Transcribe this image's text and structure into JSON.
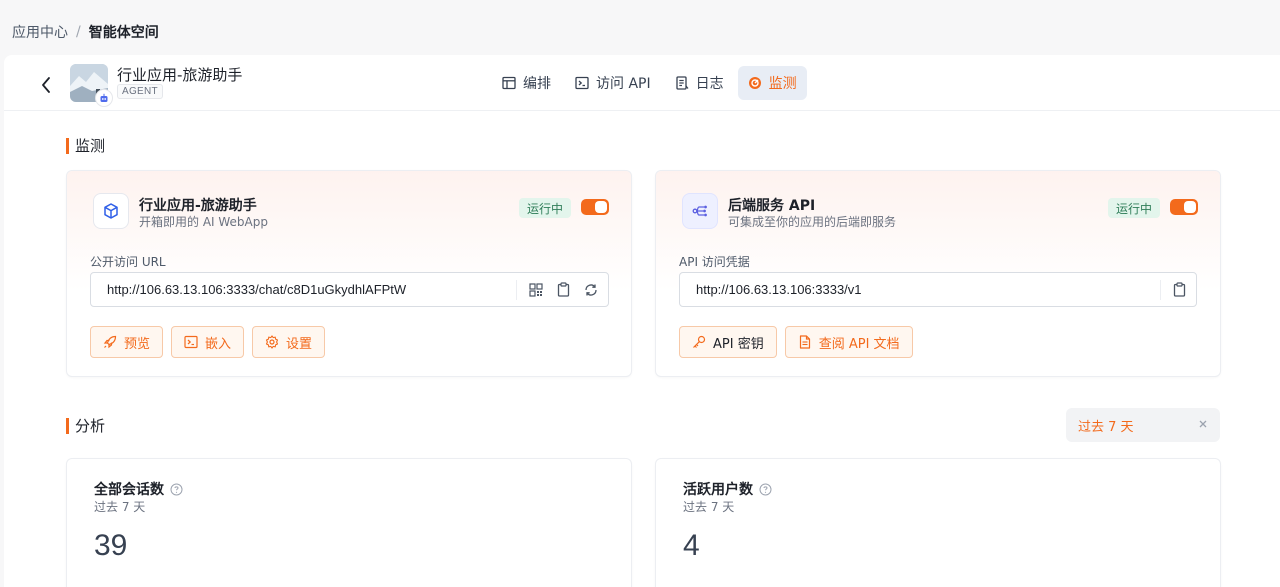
{
  "breadcrumb": {
    "root": "应用中心",
    "separator": "/",
    "current": "智能体空间"
  },
  "app": {
    "name": "行业应用-旅游助手",
    "type_tag": "AGENT",
    "thumb_icon": "snow-mountain-image",
    "badge_icon": "robot-icon"
  },
  "tabs": [
    {
      "label": "编排",
      "icon": "layout-icon",
      "active": false
    },
    {
      "label": "访问 API",
      "icon": "terminal-icon",
      "active": false
    },
    {
      "label": "日志",
      "icon": "document-icon",
      "active": false
    },
    {
      "label": "监测",
      "icon": "monitor-icon",
      "active": true
    }
  ],
  "monitor": {
    "section_title": "监测",
    "webapp": {
      "title": "行业应用-旅游助手",
      "subtitle": "开箱即用的 AI WebApp",
      "status": "运行中",
      "enabled": true,
      "url_label": "公开访问 URL",
      "url": "http://106.63.13.106:3333/chat/c8D1uGkydhlAFPtW",
      "buttons": {
        "preview": "预览",
        "embed": "嵌入",
        "settings": "设置"
      }
    },
    "backend": {
      "title": "后端服务 API",
      "subtitle": "可集成至你的应用的后端即服务",
      "status": "运行中",
      "enabled": true,
      "url_label": "API 访问凭据",
      "url": "http://106.63.13.106:3333/v1",
      "buttons": {
        "api_key": "API 密钥",
        "api_docs": "查阅 API 文档"
      }
    }
  },
  "analysis": {
    "section_title": "分析",
    "range": "过去 7 天",
    "stats": [
      {
        "title": "全部会话数",
        "sub": "过去 7 天",
        "value": "39"
      },
      {
        "title": "活跃用户数",
        "sub": "过去 7 天",
        "value": "4"
      }
    ]
  },
  "colors": {
    "accent": "#f36a1c",
    "running_bg": "#e3f5ec",
    "running_text": "#2f7d58"
  }
}
